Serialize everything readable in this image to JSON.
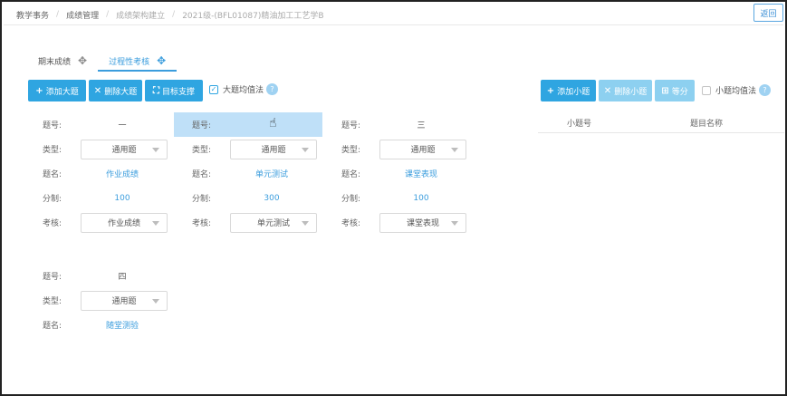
{
  "breadcrumb": {
    "items": [
      "教学事务",
      "成绩管理",
      "成绩架构建立",
      "2021级-(BFL01087)精油加工工艺学B"
    ]
  },
  "header": {
    "back_label": "返回"
  },
  "tabs": [
    {
      "label": "期末成绩",
      "active": false
    },
    {
      "label": "过程性考核",
      "active": true
    }
  ],
  "toolbar": {
    "add_question": "添加大题",
    "delete_question": "删除大题",
    "target_support": "目标支撑",
    "equal_value_label": "大题均值法",
    "equal_value_checked": true,
    "add_sub": "添加小题",
    "delete_sub": "删除小题",
    "equal_split": "等分",
    "sub_equal_label": "小题均值法",
    "sub_equal_checked": false,
    "help": "?"
  },
  "labels": {
    "number": "题号:",
    "type": "类型:",
    "name": "题名:",
    "score": "分制:",
    "assess": "考核:"
  },
  "questions": [
    {
      "number": "一",
      "type": "通用题",
      "name": "作业成绩",
      "score": "100",
      "assess": "作业成绩"
    },
    {
      "number": "",
      "type": "通用题",
      "name": "单元测试",
      "score": "300",
      "assess": "单元测试"
    },
    {
      "number": "三",
      "type": "通用题",
      "name": "课堂表现",
      "score": "100",
      "assess": "课堂表现"
    },
    {
      "number": "四",
      "type": "通用题",
      "name": "随堂测验"
    }
  ],
  "sub_table": {
    "columns": [
      "小题号",
      "题目名称"
    ]
  },
  "icons": {
    "plus": "plus-icon",
    "times": "times-icon",
    "target": "binoculars-icon",
    "sitemap": "sitemap-icon",
    "check": "check-icon",
    "caret": "caret-down-icon",
    "cursor": "hand-pointer-icon"
  },
  "colors": {
    "primary": "#2fa5e1",
    "primary_light": "#8dd0f0",
    "link": "#3b9ddd",
    "highlight": "#bfe0f8"
  }
}
